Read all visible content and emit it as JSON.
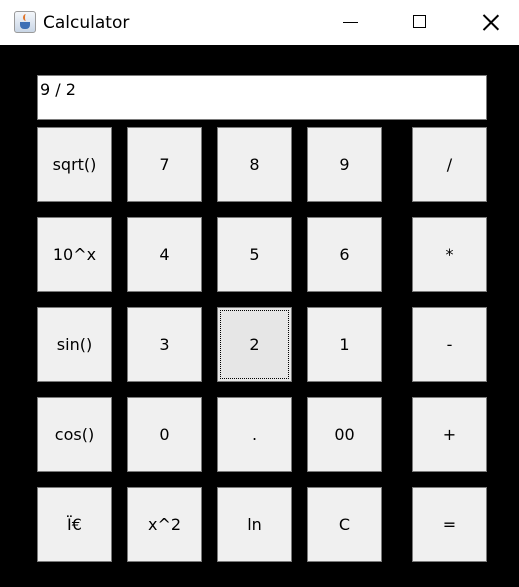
{
  "window": {
    "title": "Calculator",
    "app_icon": "java-coffee-cup-icon",
    "controls": {
      "minimize": "minimize-icon",
      "maximize": "maximize-icon",
      "close": "close-icon"
    }
  },
  "display": {
    "value": "9 / 2"
  },
  "buttons": {
    "sqrt": "sqrt()",
    "seven": "7",
    "eight": "8",
    "nine": "9",
    "divide": "/",
    "ten_pow": "10^x",
    "four": "4",
    "five": "5",
    "six": "6",
    "multiply": "*",
    "sin": "sin()",
    "three": "3",
    "two": "2",
    "one": "1",
    "minus": "-",
    "cos": "cos()",
    "zero": "0",
    "dot": ".",
    "double_zero": "00",
    "plus": "+",
    "pi": "Ï€",
    "square": "x^2",
    "ln": "ln",
    "clear": "C",
    "equals": "="
  },
  "colors": {
    "background": "#000000",
    "button_face": "#f0f0f0",
    "button_border": "#7a7a7a",
    "titlebar": "#ffffff"
  }
}
